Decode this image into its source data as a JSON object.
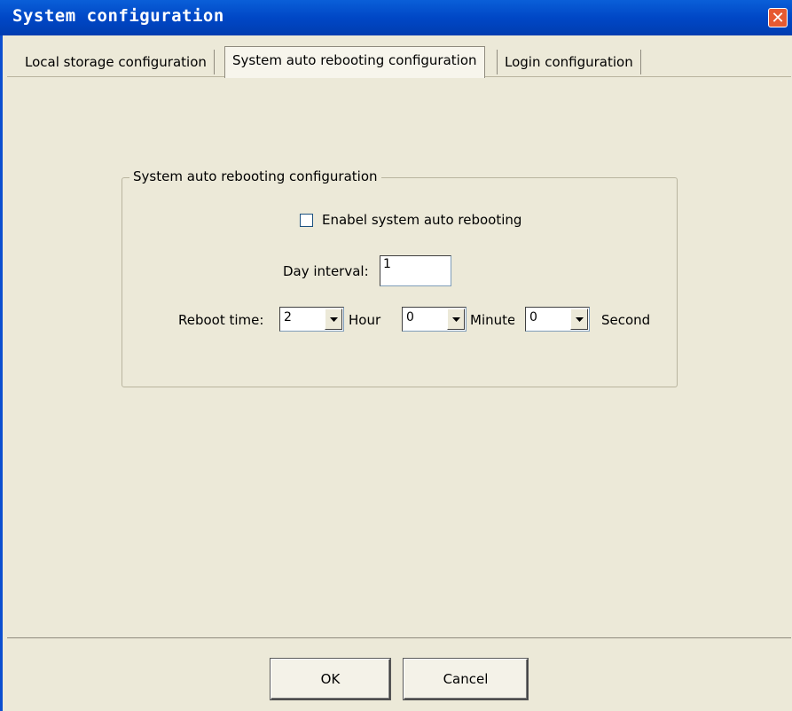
{
  "window": {
    "title": "System configuration",
    "close_glyph": "✕"
  },
  "tabs": [
    {
      "label": "Local storage configuration",
      "active": false
    },
    {
      "label": "System auto rebooting configuration",
      "active": true
    },
    {
      "label": "Login configuration",
      "active": false
    }
  ],
  "group": {
    "title": "System auto rebooting configuration",
    "enable_label": "Enabel system auto rebooting",
    "enable_checked": false,
    "day_interval_label": "Day interval:",
    "day_interval_value": "1",
    "reboot_time_label": "Reboot time:",
    "hour_value": "2",
    "hour_label": "Hour",
    "minute_value": "0",
    "minute_label": "Minute",
    "second_value": "0",
    "second_label": "Second"
  },
  "buttons": {
    "ok": "OK",
    "cancel": "Cancel"
  },
  "icons": {
    "close": "close-icon",
    "dropdown": "chevron-down-icon"
  },
  "colors": {
    "titlebar": "#0047c6",
    "close": "#e65a32",
    "face": "#ece9d8"
  }
}
